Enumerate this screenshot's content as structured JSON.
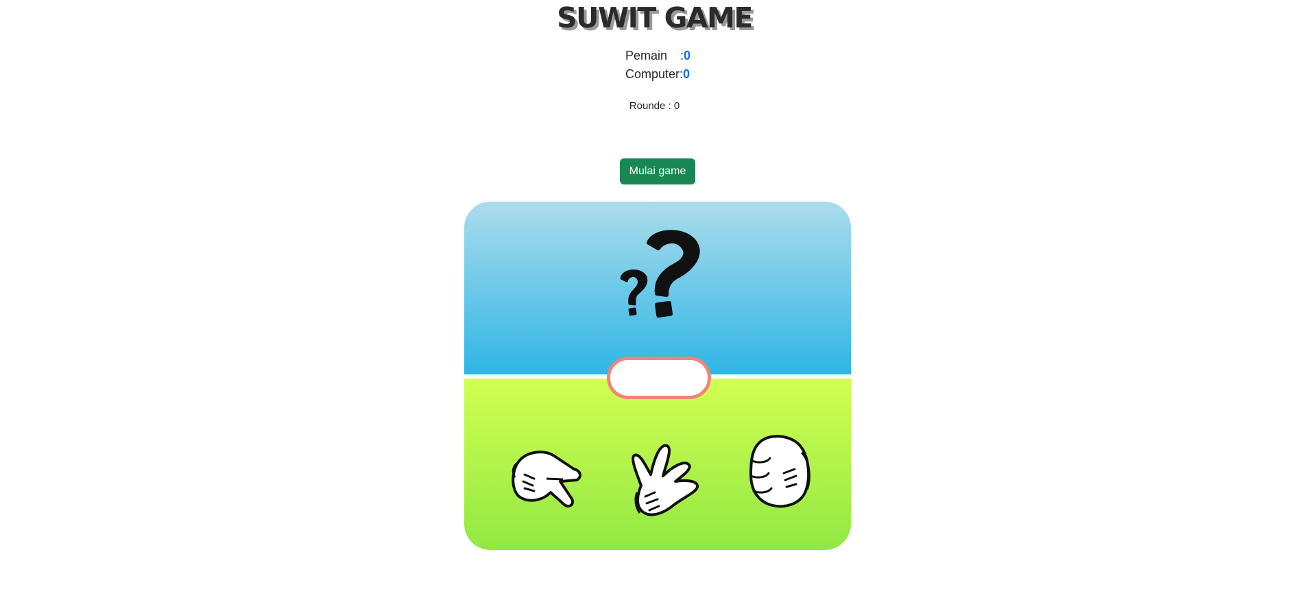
{
  "header": {
    "title": "SUWIT GAME"
  },
  "scoreboard": {
    "player_label": "Pemain",
    "player_sep": ":",
    "player_score": "0",
    "computer_label": "Computer",
    "computer_sep": ":",
    "computer_score": "0",
    "round_text": "Rounde : 0"
  },
  "controls": {
    "start_label": "Mulai game"
  },
  "board": {
    "computer_choice_icon": "question-marks-icon",
    "result_text": "",
    "player_choices": [
      {
        "name": "scissors",
        "icon": "scissors-hand-icon"
      },
      {
        "name": "paper",
        "icon": "paper-hand-icon"
      },
      {
        "name": "rock",
        "icon": "rock-hand-icon"
      }
    ]
  },
  "colors": {
    "score_value": "#0d6efd",
    "start_button": "#198754",
    "sky_top": "#acdcec",
    "sky_bottom": "#2fb6e6",
    "grass_top": "#d2ff52",
    "grass_bottom": "#91e842",
    "result_border": "#f0857a"
  }
}
